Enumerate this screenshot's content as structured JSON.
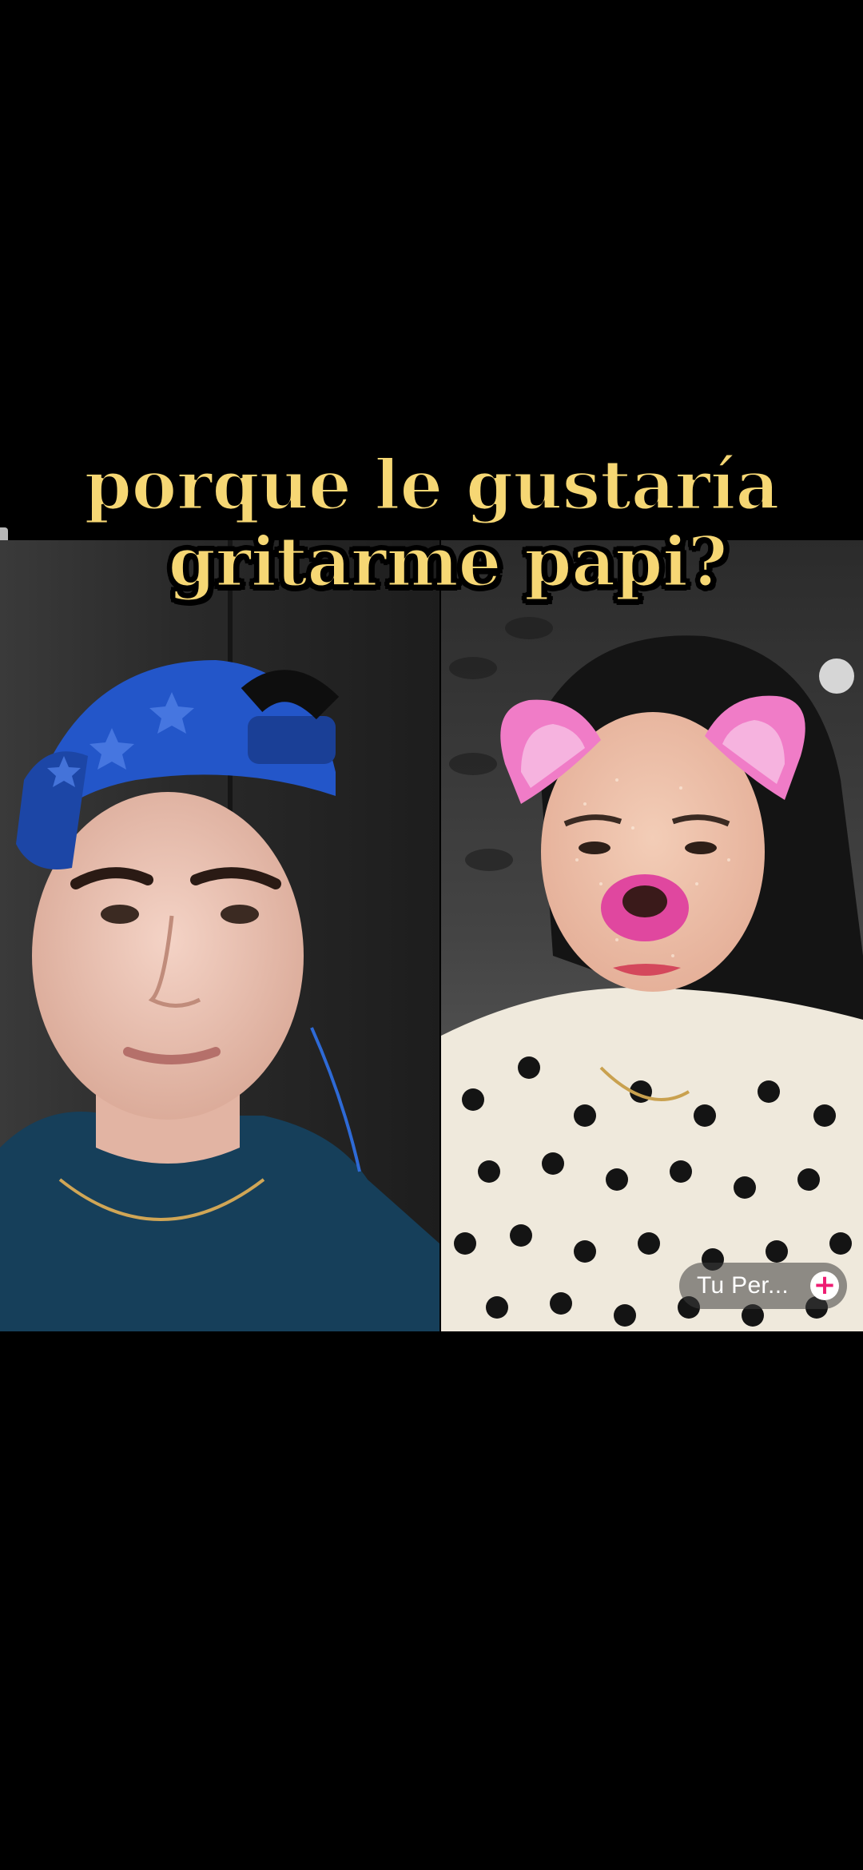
{
  "caption": {
    "line1": "porque le gustaría",
    "line2": "gritarme papi?"
  },
  "video_left": {
    "description_icon": "camera-feed-icon"
  },
  "video_right": {
    "description_icon": "camera-feed-icon"
  },
  "profile_button": {
    "label": "Tu Per...",
    "add_symbol": "+"
  },
  "colors": {
    "caption_fill": "#F6D774",
    "caption_outline": "#000000",
    "add_icon": "#EE1D73",
    "background": "#000000"
  }
}
